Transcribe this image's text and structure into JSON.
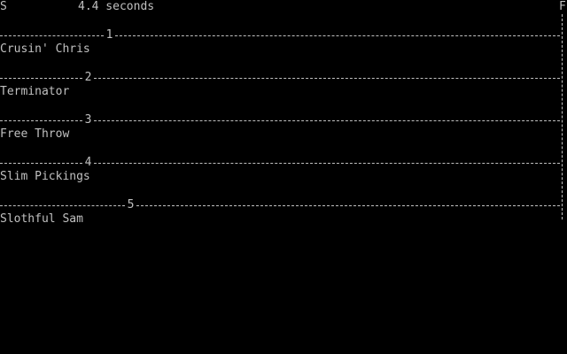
{
  "status": {
    "start_marker": "S",
    "elapsed_time": "4.4 seconds",
    "finish_marker": "F"
  },
  "racers": [
    {
      "lane": "1",
      "name": "Crusin' Chris"
    },
    {
      "lane": "2",
      "name": "Terminator"
    },
    {
      "lane": "3",
      "name": "Free Throw"
    },
    {
      "lane": "4",
      "name": "Slim Pickings"
    },
    {
      "lane": "5",
      "name": "Slothful Sam"
    }
  ],
  "colors": {
    "background": "#000000",
    "text": "#c0c0c0"
  }
}
